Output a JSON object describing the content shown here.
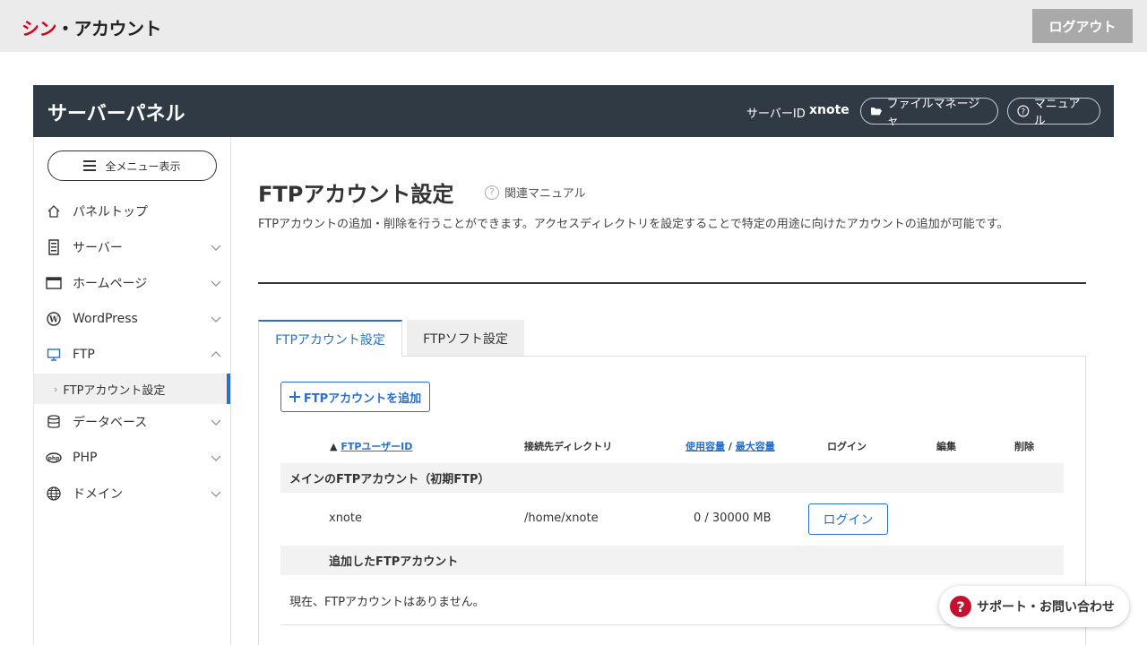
{
  "topbar": {
    "logo_part1": "シン",
    "logo_part2": "・アカウント",
    "logout_label": "ログアウト"
  },
  "panel": {
    "title": "サーバーパネル",
    "server_id_label": "サーバーID",
    "server_id_value": "xnote",
    "file_manager_label": "ファイルマネージャ",
    "manual_label": "マニュアル"
  },
  "sidebar": {
    "all_menu_label": "全メニュー表示",
    "items": [
      {
        "label": "パネルトップ",
        "icon": "home-icon"
      },
      {
        "label": "サーバー",
        "icon": "server-icon"
      },
      {
        "label": "ホームページ",
        "icon": "browser-icon"
      },
      {
        "label": "WordPress",
        "icon": "wordpress-icon"
      },
      {
        "label": "FTP",
        "icon": "monitor-icon"
      },
      {
        "label": "データベース",
        "icon": "database-icon"
      },
      {
        "label": "PHP",
        "icon": "php-icon"
      },
      {
        "label": "ドメイン",
        "icon": "globe-icon"
      }
    ],
    "sub_item": "FTPアカウント設定"
  },
  "main": {
    "title": "FTPアカウント設定",
    "related_manual": "関連マニュアル",
    "description": "FTPアカウントの追加・削除を行うことができます。アクセスディレクトリを設定することで特定の用途に向けたアカウントの追加が可能です。",
    "tabs": [
      {
        "label": "FTPアカウント設定",
        "active": true
      },
      {
        "label": "FTPソフト設定",
        "active": false
      }
    ],
    "add_button": "FTPアカウントを追加",
    "table": {
      "col_user_prefix": "▲",
      "col_user": "FTPユーザーID",
      "col_dir": "接続先ディレクトリ",
      "col_used": "使用容量",
      "col_sep": "/",
      "col_max": "最大容量",
      "col_login": "ログイン",
      "col_edit": "編集",
      "col_delete": "削除",
      "section_main": "メインのFTPアカウント（初期FTP）",
      "main_row": {
        "user": "xnote",
        "dir": "/home/xnote",
        "usage": "0 / 30000 MB",
        "login_button": "ログイン"
      },
      "section_added": "追加したFTPアカウント",
      "empty_message": "現在、FTPアカウントはありません。"
    }
  },
  "support": {
    "label": "サポート・お問い合わせ"
  },
  "colors": {
    "accent": "#2a6fc9",
    "header_bg": "#2f3a44",
    "brand_red": "#d8001c"
  }
}
